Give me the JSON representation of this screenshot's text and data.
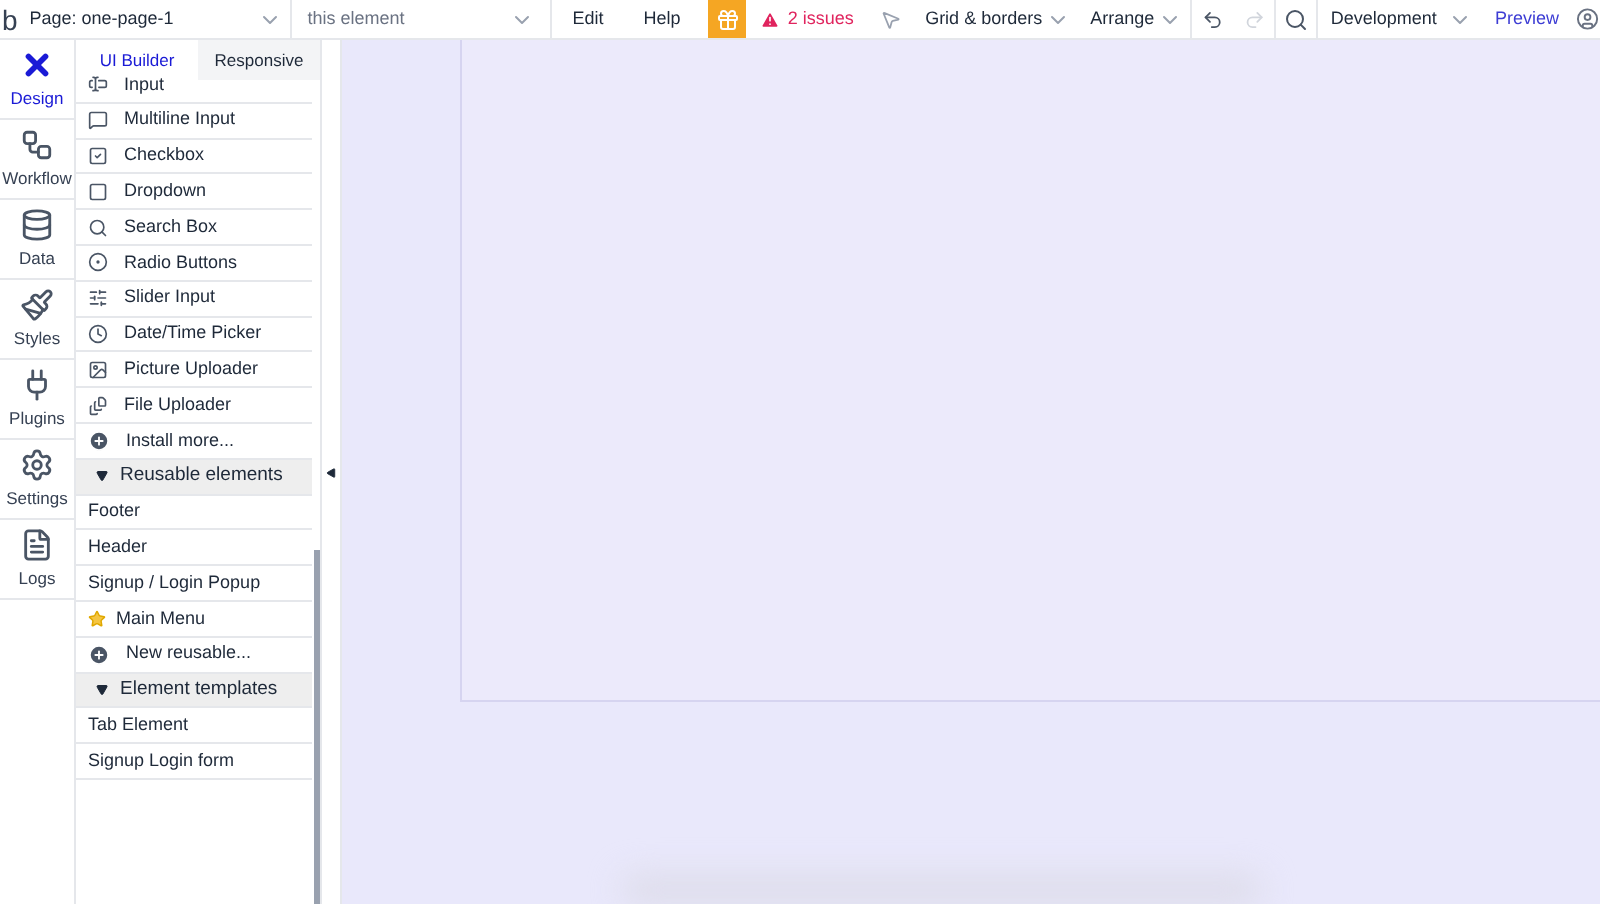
{
  "topbar": {
    "logo": "b",
    "page_dropdown": "Page: one-page-1",
    "element_dropdown": "this element",
    "menu": [
      "Edit",
      "Help"
    ],
    "issues": "2 issues",
    "grid": "Grid & borders",
    "arrange": "Arrange",
    "redo_disabled": true,
    "environment": "Development",
    "preview": "Preview"
  },
  "nav": [
    {
      "label": "Design",
      "kind": "design",
      "selected": true
    },
    {
      "label": "Workflow",
      "kind": "workflow",
      "selected": false
    },
    {
      "label": "Data",
      "kind": "data",
      "selected": false
    },
    {
      "label": "Styles",
      "kind": "styles",
      "selected": false
    },
    {
      "label": "Plugins",
      "kind": "plugins",
      "selected": false
    },
    {
      "label": "Settings",
      "kind": "settings",
      "selected": false
    },
    {
      "label": "Logs",
      "kind": "logs",
      "selected": false
    }
  ],
  "panel_tabs": [
    {
      "label": "UI Builder",
      "selected": true
    },
    {
      "label": "Responsive",
      "selected": false
    }
  ],
  "elements": [
    {
      "label": "Input",
      "kind": "input"
    },
    {
      "label": "Multiline Input",
      "kind": "multiline"
    },
    {
      "label": "Checkbox",
      "kind": "checkbox"
    },
    {
      "label": "Dropdown",
      "kind": "dropdown"
    },
    {
      "label": "Search Box",
      "kind": "search"
    },
    {
      "label": "Radio Buttons",
      "kind": "radio"
    },
    {
      "label": "Slider Input",
      "kind": "slider"
    },
    {
      "label": "Date/Time Picker",
      "kind": "clock"
    },
    {
      "label": "Picture Uploader",
      "kind": "picture"
    },
    {
      "label": "File Uploader",
      "kind": "file"
    },
    {
      "label": "Install more...",
      "kind": "add"
    },
    {
      "label": "Reusable elements",
      "kind": "section",
      "expanded": true
    },
    {
      "label": "Footer",
      "kind": "plain"
    },
    {
      "label": "Header",
      "kind": "plain"
    },
    {
      "label": "Signup / Login Popup",
      "kind": "plain"
    },
    {
      "label": "Main Menu",
      "kind": "star"
    },
    {
      "label": "New reusable...",
      "kind": "add"
    },
    {
      "label": "Element templates",
      "kind": "section",
      "expanded": true
    },
    {
      "label": "Tab Element",
      "kind": "plain"
    },
    {
      "label": "Signup Login form",
      "kind": "plain"
    }
  ]
}
